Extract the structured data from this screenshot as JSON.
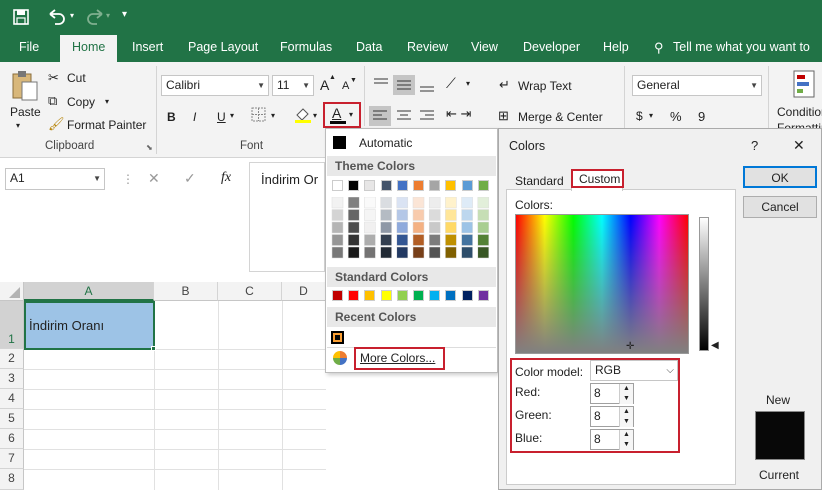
{
  "quick_access": {
    "save_icon": "save-icon",
    "undo_icon": "undo-icon",
    "redo_icon": "redo-icon",
    "customize_icon": "chevron-down-icon"
  },
  "tabs": [
    "File",
    "Home",
    "Insert",
    "Page Layout",
    "Formulas",
    "Data",
    "Review",
    "View",
    "Developer",
    "Help"
  ],
  "tell_me": "Tell me what you want to do",
  "clipboard": {
    "paste": "Paste",
    "cut": "Cut",
    "copy": "Copy",
    "format_painter": "Format Painter",
    "group": "Clipboard"
  },
  "font": {
    "name": "Calibri",
    "size": "11",
    "bold": "B",
    "italic": "I",
    "underline": "U",
    "font_color_glyph": "A",
    "group": "Font",
    "grow": "A",
    "shrink": "A"
  },
  "alignment": {
    "wrap_text": "Wrap Text",
    "merge_center": "Merge & Center"
  },
  "number": {
    "format": "General",
    "currency": "$",
    "percent": "%",
    "comma": "9"
  },
  "styles": {
    "conditional": "Condition",
    "conditional2": "Formattin"
  },
  "formula_bar": {
    "name_box": "A1",
    "fx": "fx",
    "content": "İndirim Or"
  },
  "grid": {
    "columns": [
      "A",
      "B",
      "C",
      "D"
    ],
    "rows": [
      "1",
      "2",
      "3",
      "4",
      "5",
      "6",
      "7",
      "8"
    ],
    "cell_a1": "İndirim Oranı"
  },
  "font_color_menu": {
    "automatic": "Automatic",
    "theme_colors": "Theme Colors",
    "standard_colors": "Standard Colors",
    "recent_colors": "Recent Colors",
    "more_colors": "More Colors...",
    "theme_top": [
      "#ffffff",
      "#000000",
      "#e7e6e6",
      "#44546a",
      "#4472c4",
      "#ed7d31",
      "#a5a5a5",
      "#ffc000",
      "#5b9bd5",
      "#70ad47"
    ],
    "standard": [
      "#c00000",
      "#ff0000",
      "#ffc000",
      "#ffff00",
      "#92d050",
      "#00b050",
      "#00b0f0",
      "#0070c0",
      "#002060",
      "#7030a0"
    ],
    "recent": [
      "#080808"
    ]
  },
  "colors_dialog": {
    "title": "Colors",
    "help": "?",
    "close": "✕",
    "tab_standard": "Standard",
    "tab_custom": "Custom",
    "colors_label": "Colors:",
    "ok": "OK",
    "cancel": "Cancel",
    "color_model_label": "Color model:",
    "color_model_value": "RGB",
    "red_label": "Red:",
    "green_label": "Green:",
    "blue_label": "Blue:",
    "red": "8",
    "green": "8",
    "blue": "8",
    "new": "New",
    "current": "Current",
    "new_color": "#080808",
    "current_color": "#080808"
  }
}
